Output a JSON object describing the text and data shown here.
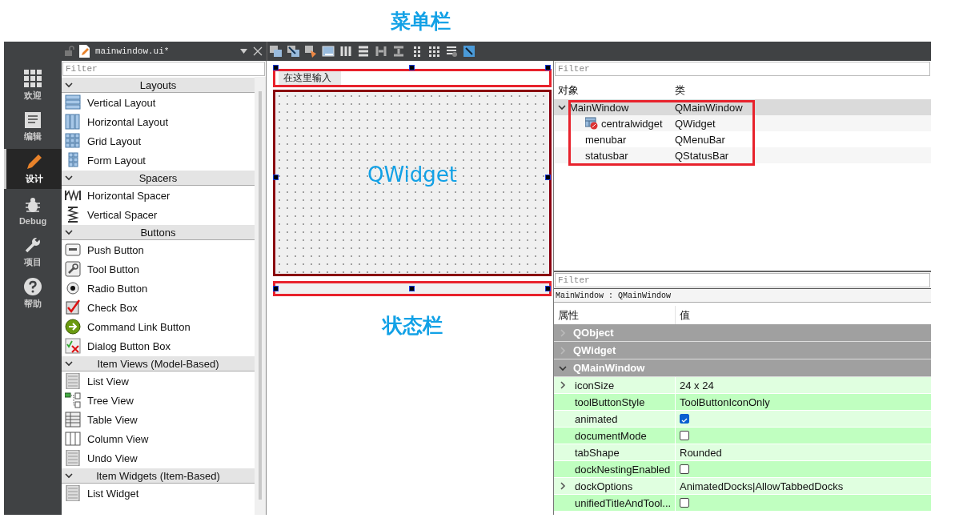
{
  "annotations": {
    "menubar_label": "菜单栏",
    "central_label": "QWidget",
    "statusbar_label": "状态栏"
  },
  "modes": [
    {
      "label": "欢迎",
      "kind": "grid",
      "selected": false
    },
    {
      "label": "编辑",
      "kind": "doc",
      "selected": false
    },
    {
      "label": "设计",
      "kind": "pencil",
      "selected": true
    },
    {
      "label": "Debug",
      "kind": "bug",
      "selected": false
    },
    {
      "label": "项目",
      "kind": "wrench",
      "selected": false
    },
    {
      "label": "帮助",
      "kind": "help",
      "selected": false
    }
  ],
  "document": {
    "file_name": "mainwindow.ui*"
  },
  "widget_box": {
    "filter_placeholder": "Filter",
    "groups": [
      {
        "title": "Layouts",
        "expanded": true,
        "items": [
          {
            "label": "Vertical Layout",
            "kind": "vlayout"
          },
          {
            "label": "Horizontal Layout",
            "kind": "hlayout"
          },
          {
            "label": "Grid Layout",
            "kind": "grid"
          },
          {
            "label": "Form Layout",
            "kind": "form"
          }
        ]
      },
      {
        "title": "Spacers",
        "expanded": true,
        "items": [
          {
            "label": "Horizontal Spacer",
            "kind": "hspacer"
          },
          {
            "label": "Vertical Spacer",
            "kind": "vspacer"
          }
        ]
      },
      {
        "title": "Buttons",
        "expanded": true,
        "items": [
          {
            "label": "Push Button",
            "kind": "push"
          },
          {
            "label": "Tool Button",
            "kind": "tool"
          },
          {
            "label": "Radio Button",
            "kind": "radio"
          },
          {
            "label": "Check Box",
            "kind": "check"
          },
          {
            "label": "Command Link Button",
            "kind": "link"
          },
          {
            "label": "Dialog Button Box",
            "kind": "dialog"
          }
        ]
      },
      {
        "title": "Item Views (Model-Based)",
        "expanded": true,
        "items": [
          {
            "label": "List View",
            "kind": "list"
          },
          {
            "label": "Tree View",
            "kind": "tree"
          },
          {
            "label": "Table View",
            "kind": "table"
          },
          {
            "label": "Column View",
            "kind": "column"
          },
          {
            "label": "Undo View",
            "kind": "list"
          }
        ]
      },
      {
        "title": "Item Widgets (Item-Based)",
        "expanded": true,
        "items": [
          {
            "label": "List Widget",
            "kind": "list"
          }
        ]
      }
    ]
  },
  "form": {
    "menu_placeholder": "在这里输入"
  },
  "object_inspector": {
    "filter_placeholder": "Filter",
    "columns": [
      "对象",
      "类"
    ],
    "rows": [
      {
        "object": "MainWindow",
        "class": "QMainWindow",
        "selected": true,
        "expanded": true,
        "children": [
          {
            "object": "centralwidget",
            "class": "QWidget",
            "selected": false,
            "has_icon": true
          },
          {
            "object": "menubar",
            "class": "QMenuBar",
            "selected": false
          },
          {
            "object": "statusbar",
            "class": "QStatusBar",
            "selected": false
          }
        ]
      }
    ]
  },
  "property_editor": {
    "filter_placeholder": "Filter",
    "class_label": "MainWindow : QMainWindow",
    "columns": [
      "属性",
      "值"
    ],
    "groups": [
      {
        "title": "QObject",
        "expanded": false
      },
      {
        "title": "QWidget",
        "expanded": false
      },
      {
        "title": "QMainWindow",
        "expanded": true,
        "properties": [
          {
            "name": "iconSize",
            "kind": "text",
            "value": "24 x 24",
            "expandable": true
          },
          {
            "name": "toolButtonStyle",
            "kind": "text",
            "value": "ToolButtonIconOnly",
            "expandable": false
          },
          {
            "name": "animated",
            "kind": "checkbox",
            "checked": true,
            "expandable": false
          },
          {
            "name": "documentMode",
            "kind": "checkbox",
            "checked": false,
            "expandable": false
          },
          {
            "name": "tabShape",
            "kind": "text",
            "value": "Rounded",
            "expandable": false
          },
          {
            "name": "dockNestingEnabled",
            "kind": "checkbox",
            "checked": false,
            "expandable": false
          },
          {
            "name": "dockOptions",
            "kind": "text",
            "value": "AnimatedDocks|AllowTabbedDocks",
            "expandable": true
          },
          {
            "name": "unifiedTitleAndTool...",
            "kind": "checkbox",
            "checked": false,
            "expandable": false
          }
        ]
      }
    ]
  }
}
